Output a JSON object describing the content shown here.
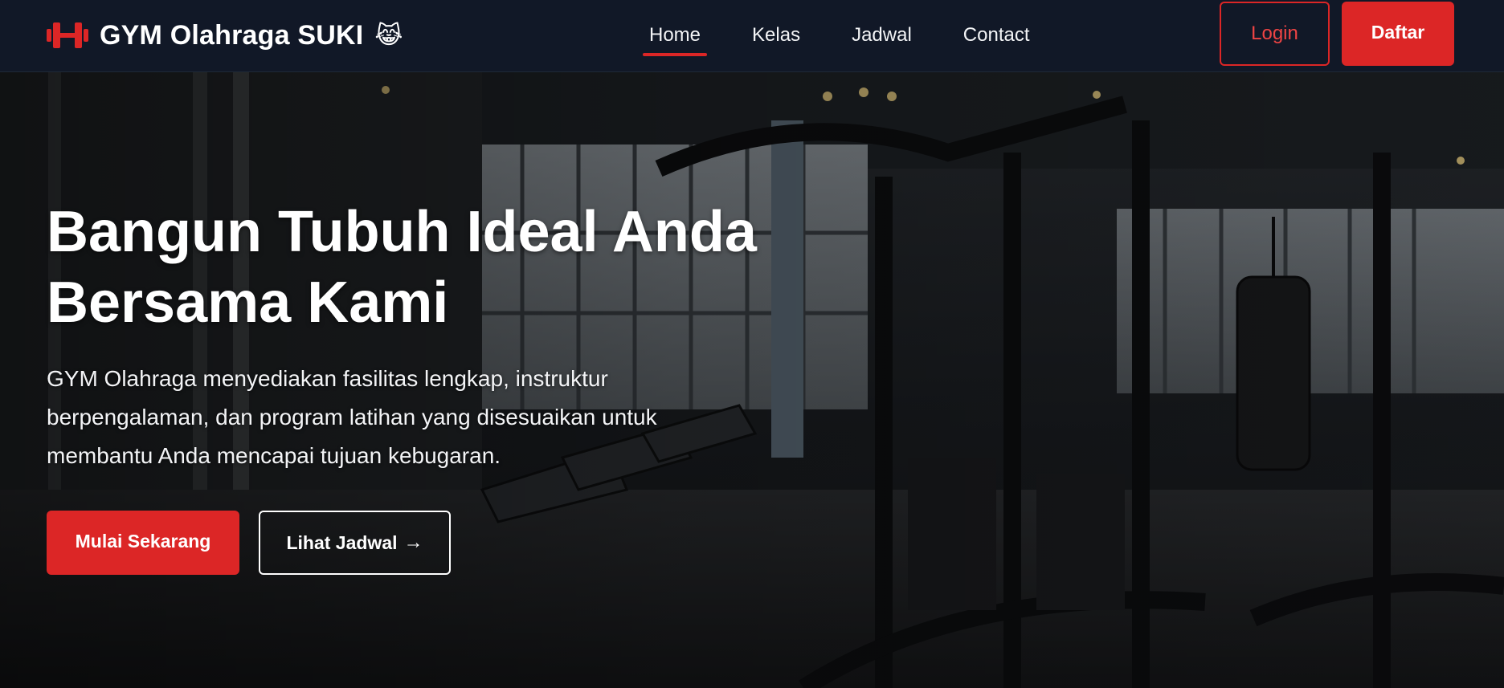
{
  "brand": {
    "name": "GYM Olahraga SUKI",
    "emoji": "😹",
    "icon": "dumbbell-icon",
    "accent_color": "#dc2626"
  },
  "nav": {
    "links": [
      {
        "label": "Home",
        "active": true
      },
      {
        "label": "Kelas",
        "active": false
      },
      {
        "label": "Jadwal",
        "active": false
      },
      {
        "label": "Contact",
        "active": false
      }
    ],
    "login_label": "Login",
    "register_label": "Daftar"
  },
  "hero": {
    "title_line1": "Bangun Tubuh Ideal Anda",
    "title_line2": "Bersama Kami",
    "desc_line1": "GYM Olahraga menyediakan fasilitas lengkap, instruktur",
    "desc_line2": "berpengalaman, dan program latihan yang disesuaikan untuk",
    "desc_line3": "membantu Anda mencapai tujuan kebugaran.",
    "primary_cta": "Mulai Sekarang",
    "secondary_cta": "Lihat Jadwal",
    "secondary_icon": "arrow-right-icon",
    "background": "gym-interior-photo"
  },
  "colors": {
    "navbar_bg": "#111827",
    "accent": "#dc2626",
    "text": "#ffffff"
  }
}
